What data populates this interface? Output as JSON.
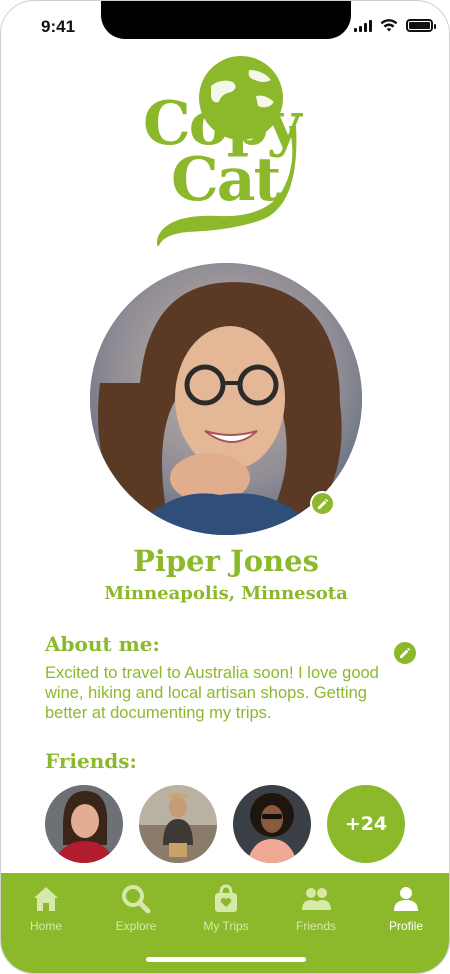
{
  "status": {
    "time": "9:41"
  },
  "logo": {
    "line1": "Copy",
    "line2": "Cat"
  },
  "profile": {
    "name": "Piper Jones",
    "location": "Minneapolis, Minnesota"
  },
  "about": {
    "title": "About me:",
    "text": "Excited to travel to Australia soon! I love good wine, hiking and local artisan shops. Getting better at documenting my trips."
  },
  "friends": {
    "title": "Friends:",
    "more_count": "+24"
  },
  "tabs": [
    {
      "label": "Home",
      "icon": "home-icon"
    },
    {
      "label": "Explore",
      "icon": "search-icon"
    },
    {
      "label": "My Trips",
      "icon": "bag-icon"
    },
    {
      "label": "Friends",
      "icon": "friends-icon"
    },
    {
      "label": "Profile",
      "icon": "profile-icon",
      "active": true
    }
  ],
  "colors": {
    "accent": "#8cb92b",
    "tab_inactive": "#d7e9a8",
    "tab_active": "#ffffff"
  }
}
